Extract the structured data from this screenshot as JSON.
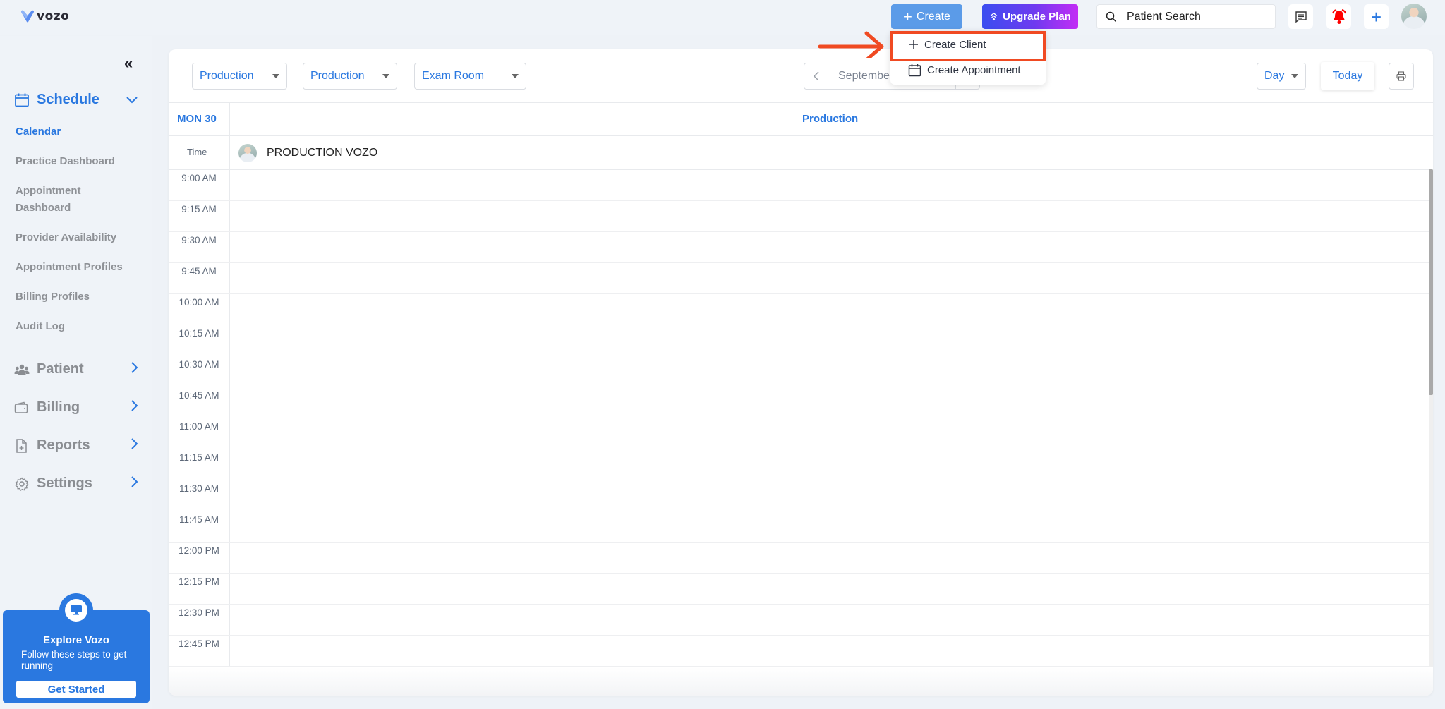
{
  "app": {
    "logo_text": "vozo"
  },
  "topbar": {
    "create_label": "Create",
    "upgrade_label": "Upgrade Plan",
    "search_placeholder": "Patient Search",
    "icons": [
      "messages-icon",
      "notification-bell-icon",
      "quick-add-icon",
      "user-avatar"
    ],
    "colors": {
      "create_bg": "#5b9be8",
      "upgrade_from": "#3b4ef0",
      "upgrade_to": "#c32cf5",
      "bell": "#ff0000"
    }
  },
  "create_menu": {
    "items": [
      {
        "label": "Create Client",
        "icon": "plus-icon",
        "highlighted": true
      },
      {
        "label": "Create Appointment",
        "icon": "calendar-icon",
        "highlighted": false
      }
    ],
    "highlight_color": "#f04a22"
  },
  "sidebar": {
    "collapse_icon": "double-chevron-left-icon",
    "schedule": {
      "label": "Schedule",
      "expanded": true,
      "items": [
        {
          "label": "Calendar",
          "active": true
        },
        {
          "label": "Practice Dashboard",
          "active": false
        },
        {
          "label": "Appointment Dashboard",
          "active": false
        },
        {
          "label": "Provider Availability",
          "active": false
        },
        {
          "label": "Appointment Profiles",
          "active": false
        },
        {
          "label": "Billing Profiles",
          "active": false
        },
        {
          "label": "Audit Log",
          "active": false
        }
      ]
    },
    "groups": [
      {
        "label": "Patient",
        "icon": "users-icon"
      },
      {
        "label": "Billing",
        "icon": "wallet-icon"
      },
      {
        "label": "Reports",
        "icon": "report-icon"
      },
      {
        "label": "Settings",
        "icon": "gear-icon"
      }
    ],
    "explore": {
      "title": "Explore Vozo",
      "description": "Follow these steps to get running",
      "button": "Get Started"
    },
    "accent": "#2a78e0"
  },
  "calendar": {
    "filters": [
      {
        "value": "Production"
      },
      {
        "value": "Production"
      },
      {
        "value": "Exam Room"
      }
    ],
    "date_label": "Septembe",
    "view": "Day",
    "today_label": "Today",
    "day_header": "MON 30",
    "column_header": "Production",
    "time_header": "Time",
    "provider_name": "PRODUCTION VOZO",
    "time_slots": [
      "9:00 AM",
      "9:15 AM",
      "9:30 AM",
      "9:45 AM",
      "10:00 AM",
      "10:15 AM",
      "10:30 AM",
      "10:45 AM",
      "11:00 AM",
      "11:15 AM",
      "11:30 AM",
      "11:45 AM",
      "12:00 PM",
      "12:15 PM",
      "12:30 PM",
      "12:45 PM"
    ]
  }
}
